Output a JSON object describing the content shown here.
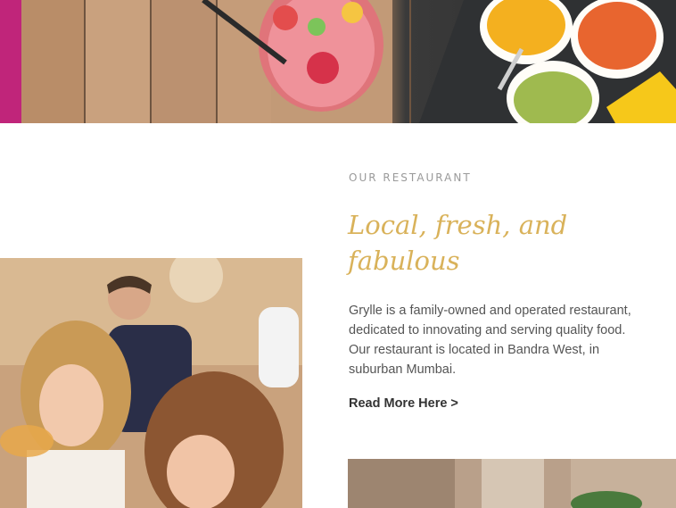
{
  "section": {
    "eyebrow": "OUR RESTAURANT",
    "headline": "Local, fresh, and fabulous",
    "body": "Grylle is a family-owned and operated restaurant, dedicated to innovating and serving quality food. Our restaurant is located in Bandra West, in suburban Mumbai.",
    "read_more": "Read More Here >"
  },
  "colors": {
    "accent_gold": "#d9b25a",
    "text_gray": "#555555",
    "eyebrow_gray": "#9a9a9a"
  },
  "images": {
    "hero": "restaurant-table-drinks-and-dips-photo",
    "left": "diners-eating-photo",
    "right": "restaurant-interior-photo"
  }
}
